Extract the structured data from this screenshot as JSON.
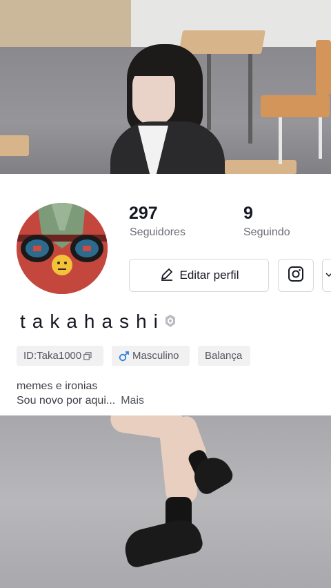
{
  "profile": {
    "followers_count": "297",
    "followers_label": "Seguidores",
    "following_count": "9",
    "following_label": "Seguindo",
    "edit_label": "Editar perfil",
    "username": "takahashi",
    "chips": [
      "ID:Taka1000",
      "Masculino",
      "Balança"
    ],
    "bio_line1": "memes e ironias",
    "bio_line2": "Sou novo por aqui...",
    "more_label": "Mais"
  },
  "colors": {
    "text_primary": "#161823",
    "text_secondary": "#6b6d75",
    "chip_bg": "#f1f1f2",
    "border": "#d6d7db",
    "male_icon": "#2f7fd8"
  },
  "icons": [
    "edit-pencil-icon",
    "instagram-icon",
    "verified-shield-icon",
    "copy-icon",
    "male-icon",
    "avatar-cartoon"
  ]
}
